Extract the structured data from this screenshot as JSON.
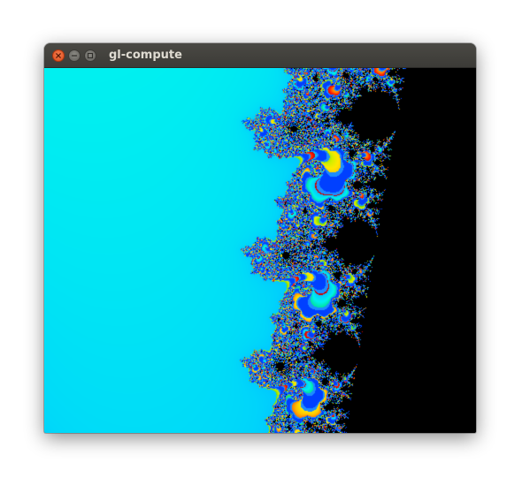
{
  "window": {
    "title": "gl-compute"
  },
  "titlebar_buttons": [
    {
      "name": "close",
      "icon": "close-icon",
      "color": "#e95420"
    },
    {
      "name": "minimize",
      "icon": "minimize-icon",
      "color": "#77766f"
    },
    {
      "name": "maximize",
      "icon": "maximize-icon",
      "color": "#77766f"
    }
  ],
  "render": {
    "content": "fractal",
    "palette": [
      "#00c8ff",
      "#00f0f0",
      "#00e08a",
      "#7ae000",
      "#d0ee00",
      "#ffe800",
      "#ffc000",
      "#ff7a00",
      "#ff1800",
      "#c80000",
      "#0040ff",
      "#1c8cff",
      "#000000"
    ]
  }
}
